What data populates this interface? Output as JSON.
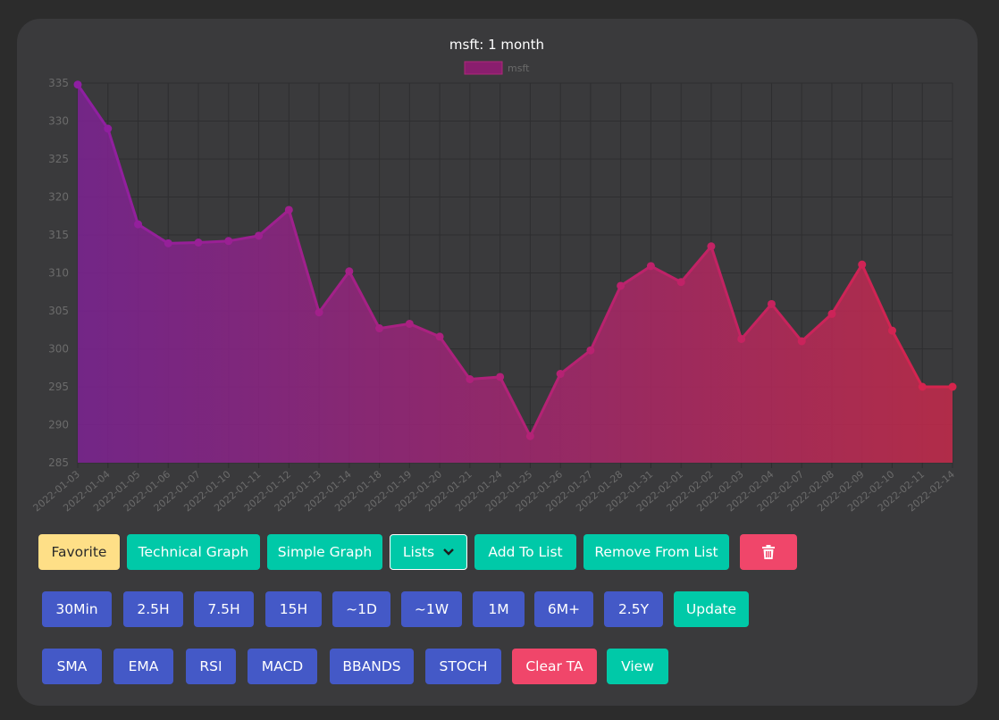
{
  "colors": {
    "page_bg": "#2c2c2c",
    "card_bg": "#3a3a3c",
    "purple": "#7d2294",
    "red": "#c62a4b",
    "teal": "#00c9a8",
    "blue": "#4459c7",
    "yellow": "#fedf87",
    "pink_red": "#f0466a"
  },
  "chart_data": {
    "type": "area",
    "title": "msft: 1 month",
    "legend": {
      "position": "top",
      "entries": [
        "msft"
      ]
    },
    "x": [
      "2022-01-03",
      "2022-01-04",
      "2022-01-05",
      "2022-01-06",
      "2022-01-07",
      "2022-01-10",
      "2022-01-11",
      "2022-01-12",
      "2022-01-13",
      "2022-01-14",
      "2022-01-18",
      "2022-01-19",
      "2022-01-20",
      "2022-01-21",
      "2022-01-24",
      "2022-01-25",
      "2022-01-26",
      "2022-01-27",
      "2022-01-28",
      "2022-01-31",
      "2022-02-01",
      "2022-02-02",
      "2022-02-03",
      "2022-02-04",
      "2022-02-07",
      "2022-02-08",
      "2022-02-09",
      "2022-02-10",
      "2022-02-11",
      "2022-02-14"
    ],
    "series": [
      {
        "name": "msft",
        "values": [
          334.8,
          329.0,
          316.4,
          313.9,
          314.0,
          314.2,
          314.9,
          318.3,
          304.8,
          310.2,
          302.7,
          303.3,
          301.6,
          296.0,
          296.3,
          288.5,
          296.7,
          299.8,
          308.3,
          310.9,
          308.8,
          313.5,
          301.3,
          305.9,
          301.0,
          304.6,
          311.1,
          302.4,
          295.0,
          295.0
        ]
      }
    ],
    "ylim": [
      285,
      335
    ],
    "yticks": [
      285,
      290,
      295,
      300,
      305,
      310,
      315,
      320,
      325,
      330,
      335
    ],
    "grid": true,
    "gradient": [
      "#7d2294",
      "#c62a4b"
    ]
  },
  "toolbar_row1": [
    {
      "label": "Favorite",
      "style": "yellow"
    },
    {
      "label": "Technical Graph",
      "style": "teal"
    },
    {
      "label": "Simple Graph",
      "style": "teal"
    },
    {
      "label": "Lists",
      "style": "teal-select"
    },
    {
      "label": "Add To List",
      "style": "teal"
    },
    {
      "label": "Remove From List",
      "style": "teal"
    },
    {
      "label": "",
      "style": "red",
      "icon": "trash-icon"
    }
  ],
  "timeframe_row": [
    "30Min",
    "2.5H",
    "7.5H",
    "15H",
    "~1D",
    "~1W",
    "1M",
    "6M+",
    "2.5Y",
    "Update"
  ],
  "indicator_row": [
    "SMA",
    "EMA",
    "RSI",
    "MACD",
    "BBANDS",
    "STOCH",
    "Clear TA",
    "View"
  ]
}
